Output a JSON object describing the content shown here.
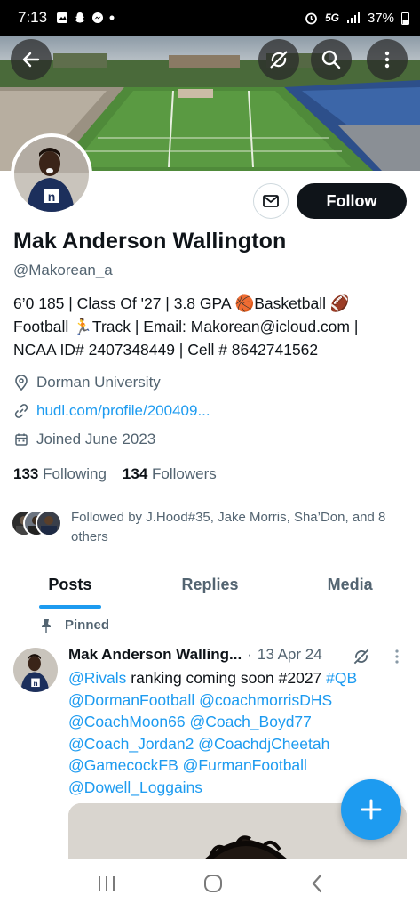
{
  "status_bar": {
    "time": "7:13",
    "network": "5G",
    "battery": "37%"
  },
  "header": {
    "back_icon": "arrow-left-icon",
    "nosync_icon": "sync-off-icon",
    "search_icon": "search-icon",
    "more_icon": "more-vertical-icon"
  },
  "profile": {
    "name": "Mak Anderson Wallington",
    "handle": "@Makorean_a",
    "bio_line1": "6’0 185 | Class Of '27 | 3.8 GPA 🏀Basketball 🏈",
    "bio_line2": "Football 🏃Track | Email: Makorean@icloud.com |",
    "bio_line3": "NCAA ID# 2407348449 | Cell # 8642741562",
    "location": "Dorman University",
    "website": "hudl.com/profile/200409...",
    "joined": "Joined June 2023",
    "following_count": "133",
    "following_label": "Following",
    "followers_count": "134",
    "followers_label": "Followers",
    "followed_by": "Followed by J.Hood#35, Jake Morris, Sha’Don, and 8 others",
    "follow_button": "Follow",
    "message_icon": "mail-icon"
  },
  "tabs": [
    {
      "label": "Posts",
      "active": true
    },
    {
      "label": "Replies",
      "active": false
    },
    {
      "label": "Media",
      "active": false
    }
  ],
  "pinned_post": {
    "pinned_label": "Pinned",
    "author": "Mak Anderson Walling...",
    "separator": "·",
    "date": "13 Apr 24",
    "text_start": "@Rivals",
    "text_mid": " ranking coming soon #2027 ",
    "hashtag": "#QB",
    "mentions_line2": "@DormanFootball @coachmorrisDHS",
    "mentions_line3": "@CoachMoon66 @Coach_Boyd77",
    "mentions_line4": "@Coach_Jordan2 @CoachdjCheetah",
    "mentions_line5": "@GamecockFB @FurmanFootball",
    "mentions_line6": "@Dowell_Loggains"
  },
  "colors": {
    "accent": "#1d9bf0",
    "text": "#0f1419",
    "muted": "#536471"
  }
}
